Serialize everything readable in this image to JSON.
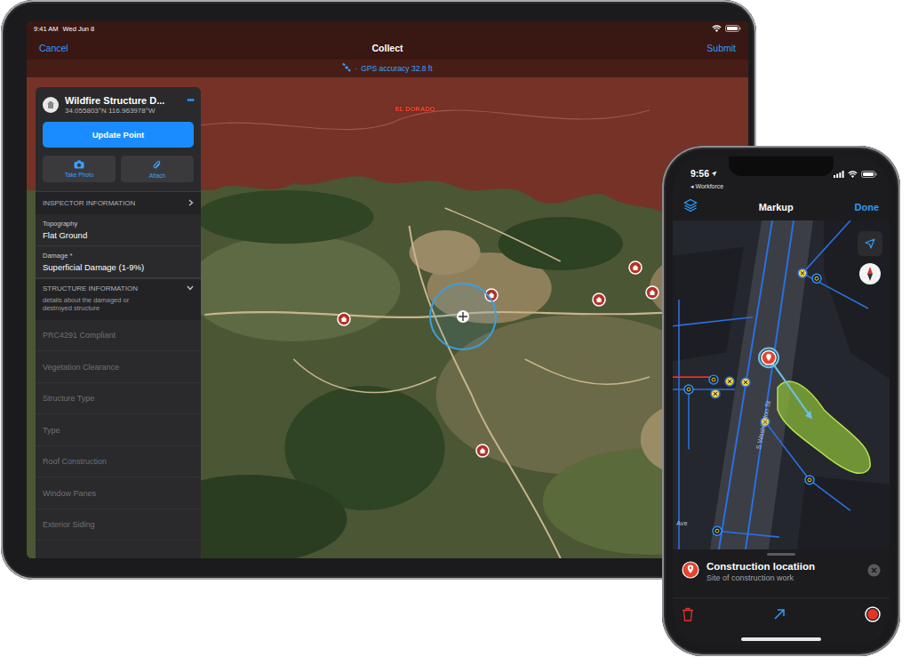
{
  "ipad": {
    "status_bar": {
      "time": "9:41 AM",
      "date": "Wed Jun 8"
    },
    "nav": {
      "cancel": "Cancel",
      "title": "Collect",
      "submit": "Submit"
    },
    "gps": {
      "separator": "·",
      "text": "GPS accuracy 32.8 ft"
    },
    "map_label": "EL DORADO",
    "panel": {
      "title": "Wildfire Structure D...",
      "coords": "34.055803°N 116.963978°W",
      "more": "•••",
      "update_button": "Update Point",
      "actions": [
        {
          "label": "Take Photo"
        },
        {
          "label": "Attach"
        }
      ],
      "inspector": {
        "title": "INSPECTOR INFORMATION",
        "expanded": false
      },
      "fields": [
        {
          "label": "Topography",
          "value": "Flat Ground"
        },
        {
          "label": "Damage *",
          "value": "Superficial Damage (1-9%)"
        }
      ],
      "structure": {
        "title": "STRUCTURE INFORMATION",
        "expanded": true,
        "description": "details about the damaged or destroyed structure"
      },
      "empty_fields": [
        "PRC4291 Compliant",
        "Vegetation Clearance",
        "Structure Type",
        "Type",
        "Roof Construction",
        "Window Panes",
        "Exterior Siding"
      ]
    }
  },
  "iphone": {
    "status_bar": {
      "time": "9:56",
      "back": "◂ Workforce"
    },
    "nav": {
      "title": "Markup",
      "done": "Done"
    },
    "map_labels": {
      "street": "S Washington St",
      "ave": "Ave"
    },
    "sheet": {
      "title": "Construction locatiion",
      "subtitle": "Site of construction work"
    }
  }
}
